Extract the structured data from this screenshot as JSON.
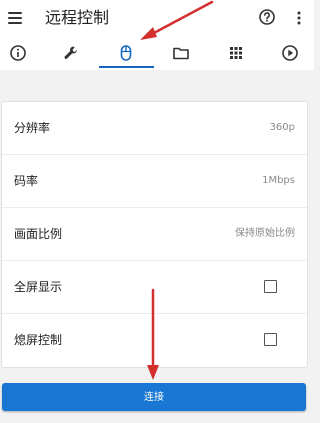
{
  "header": {
    "title": "远程控制"
  },
  "icons": {
    "menu": "menu-icon",
    "help": "help-icon",
    "more": "more-vertical-icon"
  },
  "tabs": [
    {
      "icon": "info-icon",
      "selected": false
    },
    {
      "icon": "wrench-icon",
      "selected": false
    },
    {
      "icon": "mouse-icon",
      "selected": true
    },
    {
      "icon": "folder-icon",
      "selected": false
    },
    {
      "icon": "apps-grid-icon",
      "selected": false
    },
    {
      "icon": "play-circle-icon",
      "selected": false
    }
  ],
  "settings": [
    {
      "label": "分辨率",
      "value": "360p"
    },
    {
      "label": "码率",
      "value": "1Mbps"
    },
    {
      "label": "画面比例",
      "value": "保持原始比例"
    },
    {
      "label": "全屏显示",
      "checked": false
    },
    {
      "label": "熄屏控制",
      "checked": false
    }
  ],
  "connect_label": "连接",
  "colors": {
    "accent": "#1976d2",
    "indicator": "#1565c0",
    "arrow": "#d32f2f",
    "background": "#f2f2f2"
  }
}
